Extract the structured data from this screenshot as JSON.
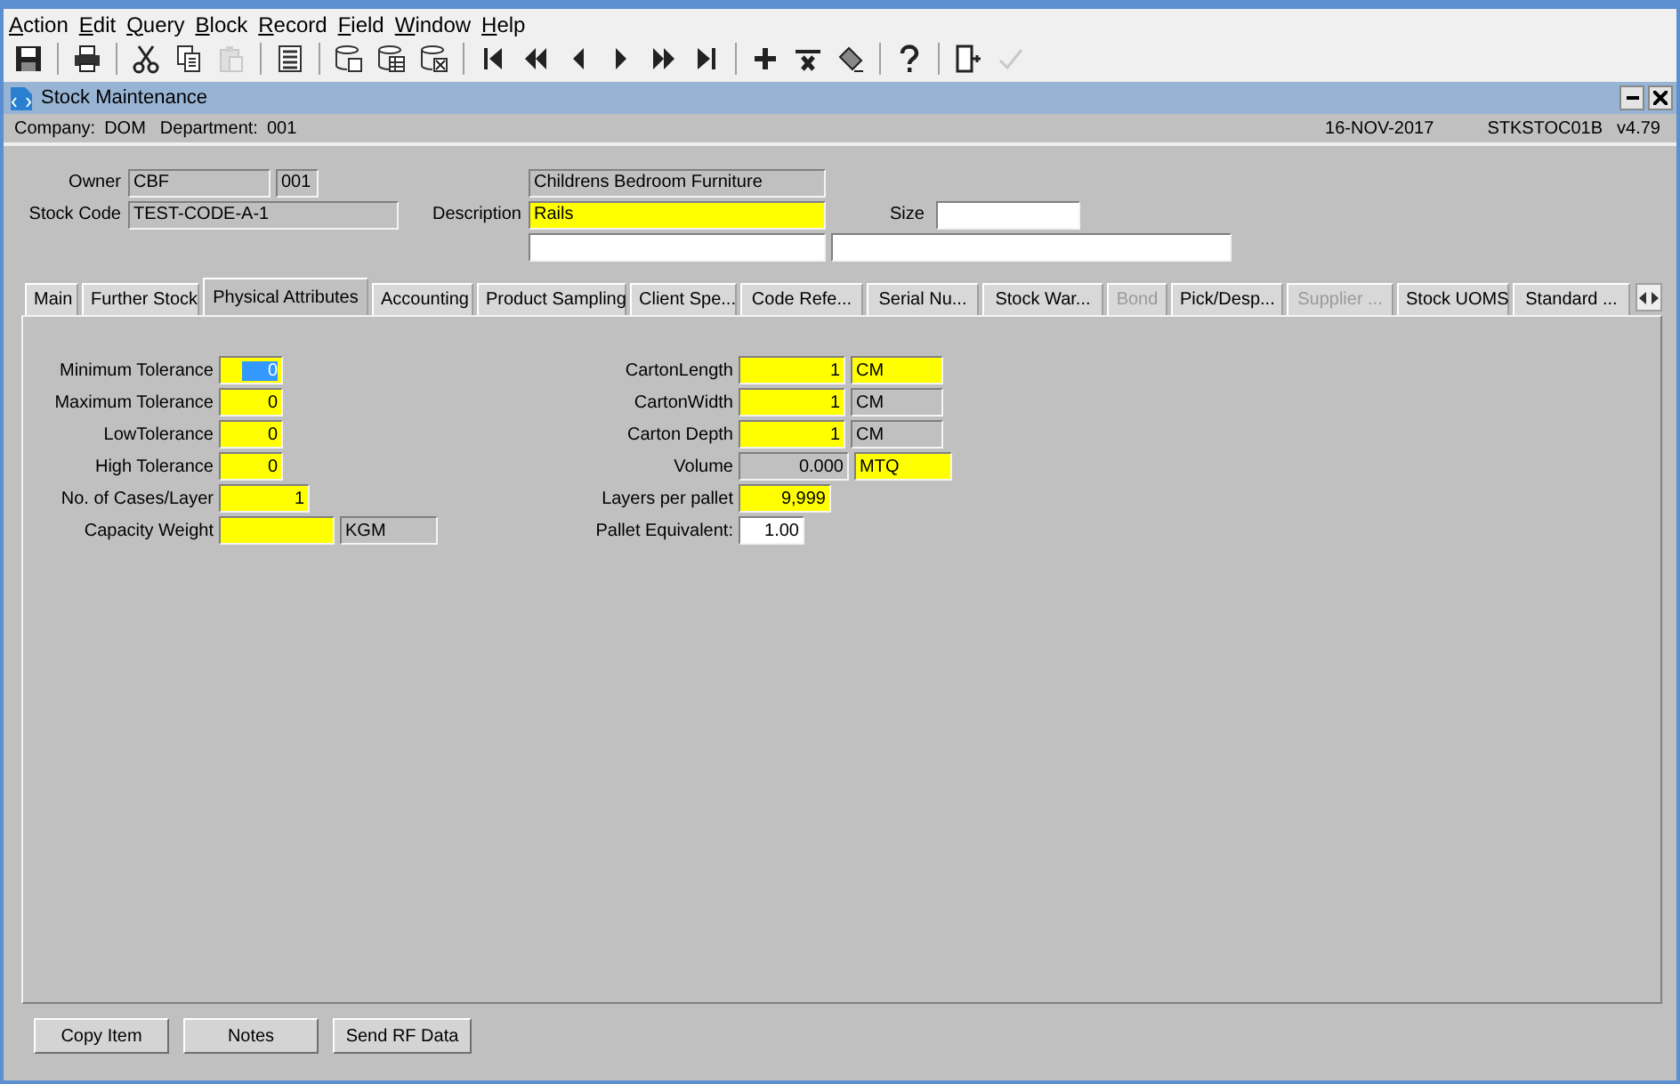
{
  "menu": [
    {
      "label": "Action"
    },
    {
      "label": "Edit"
    },
    {
      "label": "Query"
    },
    {
      "label": "Block"
    },
    {
      "label": "Record"
    },
    {
      "label": "Field"
    },
    {
      "label": "Window"
    },
    {
      "label": "Help"
    }
  ],
  "toolbar": [
    [
      {
        "disabled": false
      }
    ],
    [
      {
        "disabled": false
      }
    ],
    [
      {
        "disabled": false
      },
      {
        "disabled": false
      },
      {
        "disabled": true
      }
    ],
    [
      {
        "disabled": false
      }
    ],
    [
      {
        "disabled": false
      },
      {
        "disabled": false
      },
      {
        "disabled": false
      }
    ],
    [
      {
        "disabled": false
      },
      {
        "disabled": false
      },
      {
        "disabled": false
      },
      {
        "disabled": false
      },
      {
        "disabled": false
      },
      {
        "disabled": false
      }
    ],
    [
      {
        "disabled": false
      },
      {
        "disabled": false
      },
      {
        "disabled": false
      }
    ],
    [
      {
        "disabled": false
      }
    ],
    [
      {
        "disabled": false
      },
      {
        "disabled": true
      }
    ]
  ],
  "window": {
    "title": "Stock Maintenance"
  },
  "info_bar": {
    "company_label": "Company:",
    "company": "DOM",
    "department_label": "Department:",
    "department": "001",
    "date": "16-NOV-2017",
    "program": "STKSTOC01B",
    "version": "v4.79"
  },
  "header": {
    "owner": {
      "label": "Owner",
      "fields": [
        {
          "value": "CBF",
          "kind": "readonly"
        },
        {
          "value": "001",
          "kind": "readonly"
        }
      ]
    },
    "stock_code": {
      "label": "Stock Code",
      "fields": [
        {
          "value": "TEST-CODE-A-1",
          "kind": "readonly"
        }
      ]
    },
    "owner_name": {
      "value": "Childrens Bedroom Furniture",
      "kind": "readonly"
    },
    "description": {
      "label": "Description",
      "fields": [
        {
          "value": "Rails",
          "kind": "required"
        }
      ]
    },
    "size": {
      "label": "Size",
      "fields": [
        {
          "kind": "optional"
        }
      ]
    },
    "description_extra": [
      {
        "kind": "optional"
      },
      {
        "kind": "optional"
      }
    ]
  },
  "tabs": [
    {
      "label": "Main",
      "selected": false,
      "disabled": false
    },
    {
      "label": "Further Stock",
      "selected": false,
      "disabled": false
    },
    {
      "label": "Physical Attributes",
      "selected": true,
      "disabled": false
    },
    {
      "label": "Accounting",
      "selected": false,
      "disabled": false
    },
    {
      "label": "Product Sampling",
      "selected": false,
      "disabled": false
    },
    {
      "label": "Client Spe...",
      "selected": false,
      "disabled": false
    },
    {
      "label": "Code Refe...",
      "selected": false,
      "disabled": false
    },
    {
      "label": "Serial Nu...",
      "selected": false,
      "disabled": false
    },
    {
      "label": "Stock War...",
      "selected": false,
      "disabled": false
    },
    {
      "label": "Bond",
      "selected": false,
      "disabled": true
    },
    {
      "label": "Pick/Desp...",
      "selected": false,
      "disabled": false
    },
    {
      "label": "Supplier ...",
      "selected": false,
      "disabled": true
    },
    {
      "label": "Stock UOMS",
      "selected": false,
      "disabled": false
    },
    {
      "label": "Standard ...",
      "selected": false,
      "disabled": false
    }
  ],
  "form_left": [
    {
      "label": "Minimum Tolerance",
      "fields": [
        {
          "value": "0",
          "kind": "required",
          "focused": true
        }
      ]
    },
    {
      "label": "Maximum Tolerance",
      "fields": [
        {
          "value": "0",
          "kind": "required",
          "focused": false
        }
      ]
    },
    {
      "label": "LowTolerance",
      "fields": [
        {
          "value": "0",
          "kind": "required",
          "focused": false
        }
      ]
    },
    {
      "label": "High Tolerance",
      "fields": [
        {
          "value": "0",
          "kind": "required",
          "focused": false
        }
      ]
    },
    {
      "label": "No. of Cases/Layer",
      "fields": [
        {
          "value": "1",
          "kind": "required",
          "focused": false
        }
      ]
    },
    {
      "label": "Capacity Weight",
      "fields": [
        {
          "kind": "required",
          "focused": false
        },
        {
          "value": "KGM",
          "kind": "readonly",
          "focused": false
        }
      ]
    }
  ],
  "form_right": [
    {
      "label": "CartonLength",
      "fields": [
        {
          "value": "1",
          "kind": "required",
          "focused": false
        },
        {
          "value": "CM",
          "kind": "required",
          "focused": false
        }
      ]
    },
    {
      "label": "CartonWidth",
      "fields": [
        {
          "value": "1",
          "kind": "required",
          "focused": false
        },
        {
          "value": "CM",
          "kind": "readonly",
          "focused": false
        }
      ]
    },
    {
      "label": "Carton Depth",
      "fields": [
        {
          "value": "1",
          "kind": "required",
          "focused": false
        },
        {
          "value": "CM",
          "kind": "readonly",
          "focused": false
        }
      ]
    },
    {
      "label": "Volume",
      "fields": [
        {
          "value": "0.000",
          "kind": "readonly",
          "focused": false
        },
        {
          "value": "MTQ",
          "kind": "required",
          "focused": false
        }
      ]
    },
    {
      "label": "Layers per pallet",
      "fields": [
        {
          "value": "9,999",
          "kind": "required",
          "focused": false
        }
      ]
    },
    {
      "label": "Pallet Equivalent:",
      "fields": [
        {
          "value": "1.00",
          "kind": "optional",
          "focused": false
        }
      ]
    }
  ],
  "buttons": [
    {
      "label": "Copy Item"
    },
    {
      "label": "Notes"
    },
    {
      "label": "Send RF Data"
    }
  ]
}
